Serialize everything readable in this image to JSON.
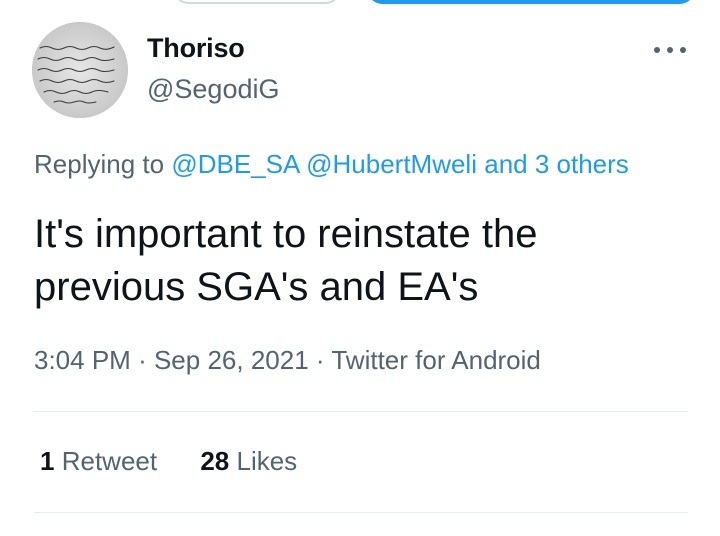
{
  "author": {
    "display_name": "Thoriso",
    "handle": "@SegodiG",
    "avatar_icon": "handwritten-note-avatar"
  },
  "reply": {
    "prefix": "Replying to",
    "mentions": [
      "@DBE_SA",
      "@HubertMweli"
    ],
    "connector": "and",
    "others": "3 others"
  },
  "tweet": {
    "text": "It's important to reinstate the previous SGA's and EA's"
  },
  "meta": {
    "time": "3:04 PM",
    "separator": "·",
    "date": "Sep 26, 2021",
    "source": "Twitter for Android"
  },
  "stats": {
    "retweets_count": "1",
    "retweets_label": "Retweet",
    "likes_count": "28",
    "likes_label": "Likes"
  },
  "colors": {
    "accent": "#1d9bf0",
    "secondary_text": "#536471",
    "primary_text": "#0f1419",
    "divider": "#e6ecf0"
  }
}
